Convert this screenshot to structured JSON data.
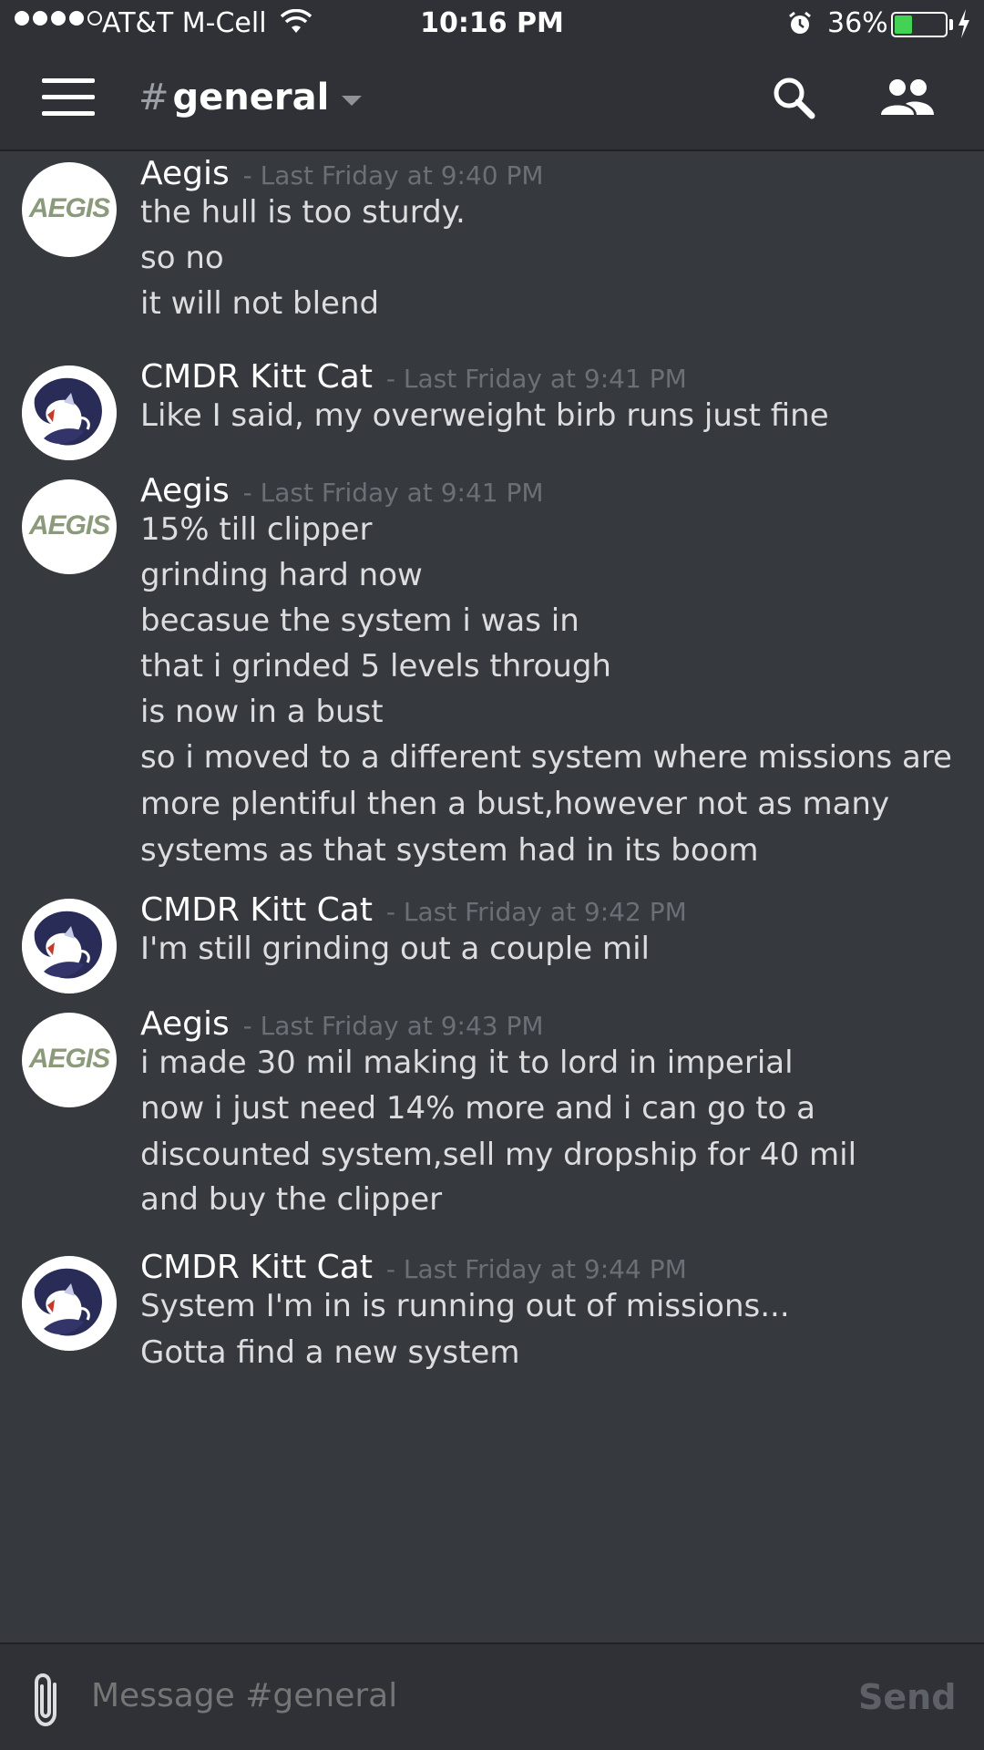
{
  "status_bar": {
    "carrier": "AT&T M-Cell",
    "time": "10:16 PM",
    "battery": "36%",
    "battery_level": 0.36,
    "signal_bars": 4
  },
  "header": {
    "hash": "#",
    "channel": "general"
  },
  "messages": [
    {
      "author": "Aegis",
      "timestamp": "- Last Friday at 9:40 PM",
      "avatar": "AEGIS",
      "lines": [
        "the hull is too sturdy.",
        "so no",
        "it will not blend"
      ]
    },
    {
      "author": "CMDR Kitt Cat",
      "timestamp": "- Last Friday at 9:41 PM",
      "avatar": "",
      "lines": [
        "Like I said, my overweight birb runs just fine"
      ]
    },
    {
      "author": "Aegis",
      "timestamp": "- Last Friday at 9:41 PM",
      "avatar": "AEGIS",
      "lines": [
        "15% till clipper",
        "grinding hard now",
        "becasue the system i was in",
        "that i grinded 5 levels through",
        "is now in a bust",
        "so i moved to a different system where missions are more plentiful then a bust,however not as many systems as that system had in its boom"
      ]
    },
    {
      "author": "CMDR Kitt Cat",
      "timestamp": "- Last Friday at 9:42 PM",
      "avatar": "",
      "lines": [
        "I'm still grinding out a couple mil"
      ]
    },
    {
      "author": "Aegis",
      "timestamp": "- Last Friday at 9:43 PM",
      "avatar": "AEGIS",
      "lines": [
        "i made 30 mil making it to lord in imperial",
        "now i just need 14% more and i can go to a discounted system,sell my dropship for 40 mil",
        "and buy the clipper"
      ]
    },
    {
      "author": "CMDR Kitt Cat",
      "timestamp": "- Last Friday at 9:44 PM",
      "avatar": "",
      "lines": [
        "System I'm in is running out of missions...\nGotta find a new system"
      ]
    }
  ],
  "composer": {
    "placeholder": "Message #general",
    "send_label": "Send"
  },
  "icons": {
    "menu": "hamburger-icon",
    "search": "search-icon",
    "members": "members-icon",
    "attach": "paperclip-icon",
    "wifi": "wifi-icon",
    "alarm": "alarm-icon"
  },
  "colors": {
    "background": "#36393e",
    "header": "#2f3136",
    "battery": "#43d354",
    "timestamp": "#6c6f75"
  }
}
